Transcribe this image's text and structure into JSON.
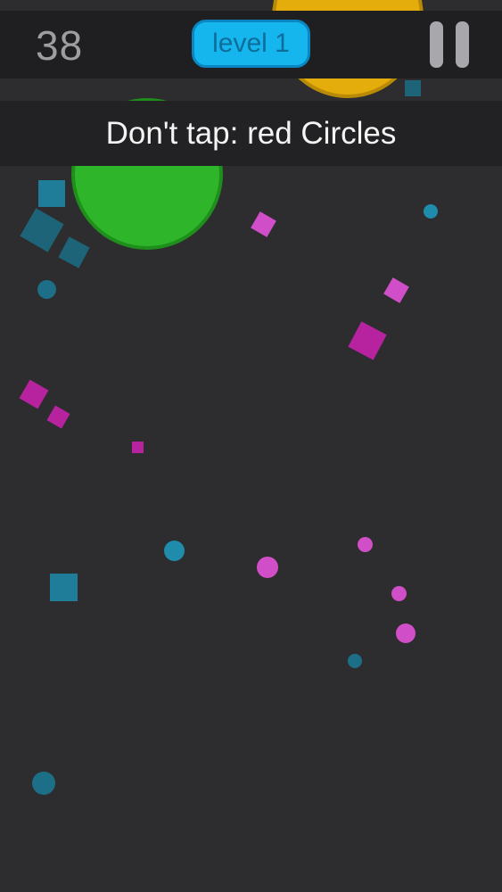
{
  "hud": {
    "score": "38",
    "level_label": "level 1",
    "pause_icon": "pause-icon"
  },
  "rule": {
    "text": "Don't tap: red Circles"
  },
  "colors": {
    "background": "#2d2d2f",
    "hud_bar": "#1f1f21",
    "level_pill": "#15b6ee",
    "green": "#2fb52a",
    "yellow": "#e6b00e",
    "magenta": "#c238b6",
    "teal": "#1f7f9a"
  }
}
